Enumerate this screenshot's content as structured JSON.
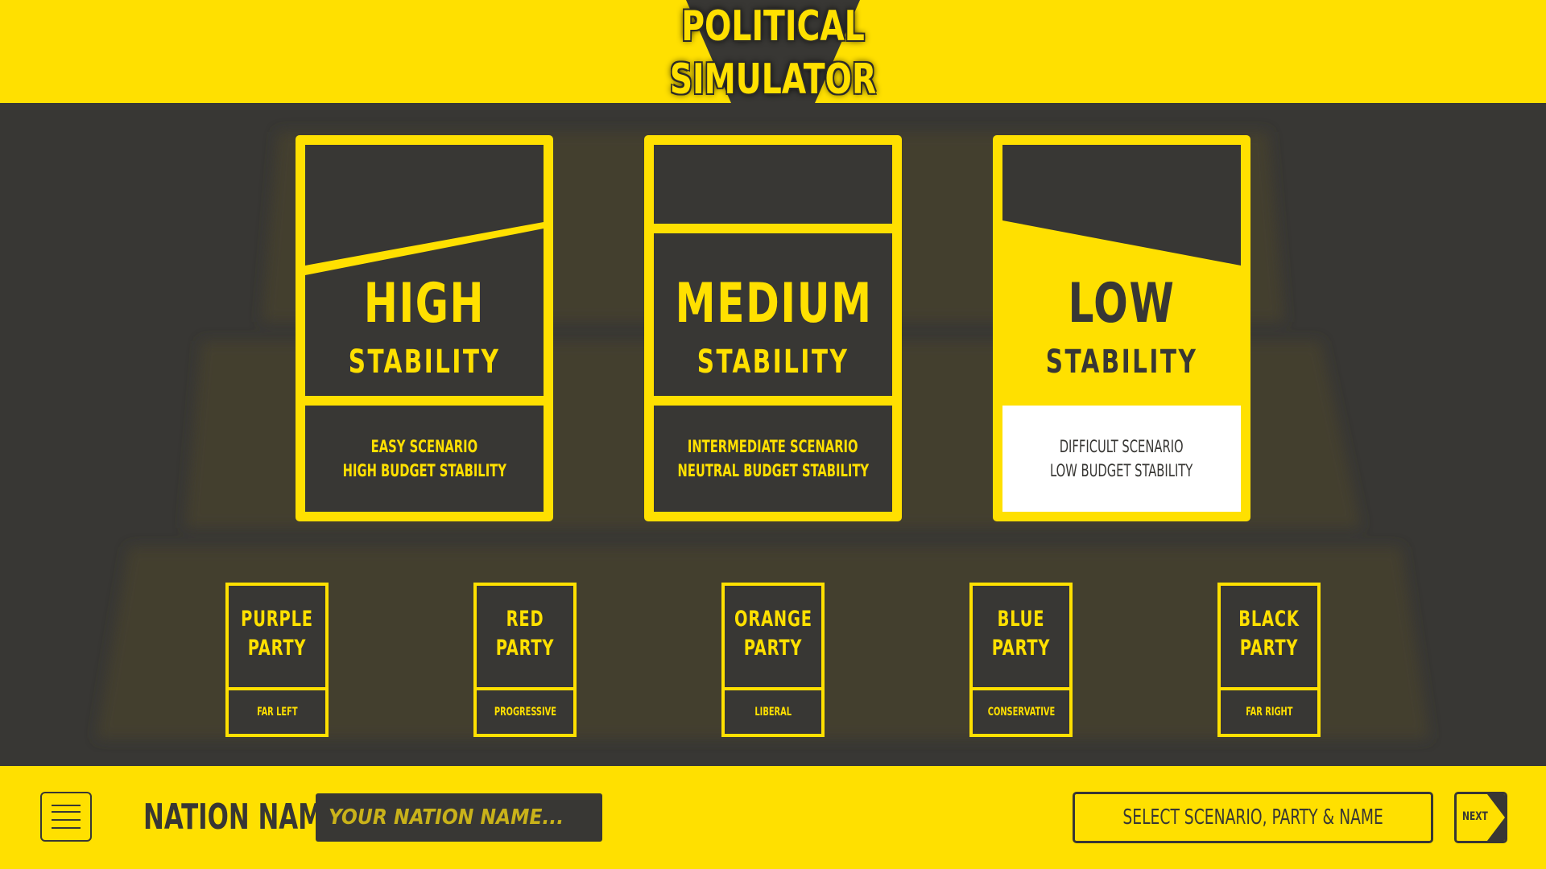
{
  "header": {
    "title_line1": "POLITICAL",
    "title_line2": "SIMULATOR"
  },
  "colors": {
    "accent": "#FFE000",
    "background": "#383734",
    "selected_desc": "#FFFFFF"
  },
  "stability_cards": [
    {
      "line1": "HIGH",
      "line2": "STABILITY",
      "desc1": "EASY SCENARIO",
      "desc2": "HIGH BUDGET STABILITY",
      "selected": false
    },
    {
      "line1": "MEDIUM",
      "line2": "STABILITY",
      "desc1": "INTERMEDIATE SCENARIO",
      "desc2": "NEUTRAL BUDGET STABILITY",
      "selected": false
    },
    {
      "line1": "LOW",
      "line2": "STABILITY",
      "desc1": "DIFFICULT SCENARIO",
      "desc2": "LOW BUDGET STABILITY",
      "selected": true
    }
  ],
  "parties": [
    {
      "name1": "PURPLE",
      "name2": "PARTY",
      "label": "FAR LEFT"
    },
    {
      "name1": "RED",
      "name2": "PARTY",
      "label": "PROGRESSIVE"
    },
    {
      "name1": "ORANGE",
      "name2": "PARTY",
      "label": "LIBERAL"
    },
    {
      "name1": "BLUE",
      "name2": "PARTY",
      "label": "CONSERVATIVE"
    },
    {
      "name1": "BLACK",
      "name2": "PARTY",
      "label": "FAR RIGHT"
    }
  ],
  "footer": {
    "menu_icon": "hamburger-menu-icon",
    "nation_label": "NATION NAME",
    "nation_placeholder": "YOUR NATION NAME...",
    "nation_value": "",
    "select_prompt": "SELECT SCENARIO, PARTY & NAME",
    "next_label": "NEXT",
    "next_icon": "arrow-right-icon"
  }
}
